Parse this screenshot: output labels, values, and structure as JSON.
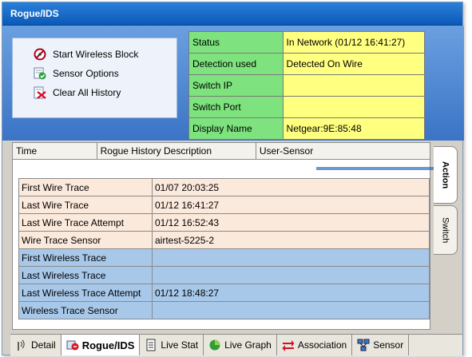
{
  "window": {
    "title": "Rogue/IDS"
  },
  "actions": [
    {
      "label": "Start Wireless Block",
      "icon": "wireless-block-icon"
    },
    {
      "label": "Sensor Options",
      "icon": "sensor-options-icon"
    },
    {
      "label": "Clear All History",
      "icon": "clear-history-icon"
    }
  ],
  "status": [
    {
      "key": "Status",
      "value": "In Network (01/12 16:41:27)"
    },
    {
      "key": "Detection used",
      "value": "Detected On Wire"
    },
    {
      "key": "Switch IP",
      "value": ""
    },
    {
      "key": "Switch Port",
      "value": ""
    },
    {
      "key": "Display Name",
      "value": "Netgear:9E:85:48"
    }
  ],
  "history": {
    "columns": [
      "Time",
      "Rogue History Description",
      "User-Sensor"
    ]
  },
  "traces": [
    {
      "key": "First Wire Trace",
      "value": "01/07 20:03:25",
      "kind": "wire"
    },
    {
      "key": "Last Wire Trace",
      "value": "01/12 16:41:27",
      "kind": "wire"
    },
    {
      "key": "Last Wire Trace Attempt",
      "value": "01/12 16:52:43",
      "kind": "wire"
    },
    {
      "key": "Wire Trace Sensor",
      "value": "airtest-5225-2",
      "kind": "wire"
    },
    {
      "key": "First Wireless Trace",
      "value": "",
      "kind": "wless"
    },
    {
      "key": "Last Wireless Trace",
      "value": "",
      "kind": "wless"
    },
    {
      "key": "Last Wireless Trace Attempt",
      "value": "01/12 18:48:27",
      "kind": "wless"
    },
    {
      "key": "Wireless Trace Sensor",
      "value": "",
      "kind": "wless"
    }
  ],
  "side_tabs": [
    {
      "label": "Action",
      "active": true
    },
    {
      "label": "Switch",
      "active": false
    }
  ],
  "bottom_tabs": [
    {
      "label": "Detail",
      "icon": "signal-icon",
      "active": false
    },
    {
      "label": "Rogue/IDS",
      "icon": "rogue-icon",
      "active": true
    },
    {
      "label": "Live Stat",
      "icon": "document-icon",
      "active": false
    },
    {
      "label": "Live Graph",
      "icon": "pie-chart-icon",
      "active": false
    },
    {
      "label": "Association",
      "icon": "association-arrows-icon",
      "active": false
    },
    {
      "label": "Sensor",
      "icon": "network-icon",
      "active": false
    }
  ],
  "colors": {
    "title_bar": "#0b5ab8",
    "status_key": "#7ee37e",
    "status_value": "#ffff80",
    "wire_row": "#fbe9dc",
    "wireless_row": "#a8c8ea"
  }
}
